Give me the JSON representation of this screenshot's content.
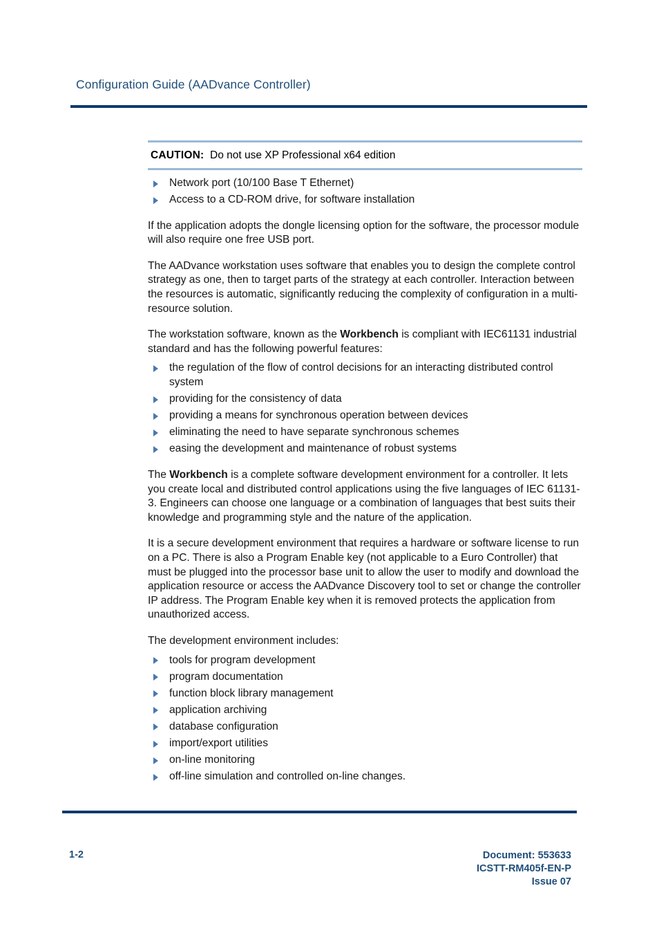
{
  "header": {
    "title": "Configuration Guide (AADvance Controller)",
    "title_color": "#1f4e79",
    "rule_color": "#0d3a6b"
  },
  "caution": {
    "label": "CAUTION:",
    "text": "Do not use XP Professional x64 edition",
    "rule_color": "#9ab9d6",
    "items": [
      "Network port (10/100 Base T Ethernet)",
      "Access to a CD-ROM drive, for software installation"
    ]
  },
  "body": {
    "bullet_color": "#4a78ac",
    "para_dongle": "If the application adopts the dongle licensing option for the software, the processor module will also require one free USB port.",
    "para_workstation": "The AADvance workstation uses software that enables you to design the complete control strategy as one, then to target parts of the strategy at each controller. Interaction between the resources is automatic, significantly reducing the complexity of configuration in a multi-resource solution.",
    "para_workbench_intro_pre": "The workstation software, known as the ",
    "para_workbench_intro_bold": "Workbench",
    "para_workbench_intro_post": " is compliant with IEC61131 industrial standard and has the following powerful features:",
    "features": [
      "the regulation of the flow of control decisions for an interacting distributed control system",
      "providing for the consistency of data",
      "providing a means for synchronous operation between devices",
      "eliminating the need to have separate synchronous schemes",
      "easing the development and maintenance of robust systems"
    ],
    "para_workbench_desc_pre": "The ",
    "para_workbench_desc_bold": "Workbench",
    "para_workbench_desc_post": " is a complete software development environment for a controller. It lets you create local and distributed control applications using the five languages of IEC 61131-3. Engineers can choose one language or a combination of languages that best suits their knowledge and programming style and the nature of the application.",
    "para_secure": "It is a secure development environment that requires a hardware or software license to run on a PC. There is also a Program Enable key (not applicable to a Euro Controller) that must be plugged into the processor base unit to allow the user to modify and download the application resource or access the AADvance Discovery tool to set or change the controller IP address. The Program Enable key when it is removed protects the application from unauthorized access.",
    "para_dev_env": "The development environment includes:",
    "dev_env_items": [
      "tools for program development",
      "program documentation",
      "function block library management",
      "application archiving",
      "database configuration",
      "import/export utilities",
      "on-line monitoring",
      "off-line simulation and controlled on-line changes."
    ]
  },
  "footer": {
    "page_number": "1-2",
    "document": "Document: 553633",
    "part_number": "ICSTT-RM405f-EN-P",
    "issue": "Issue 07",
    "rule_color": "#0d3a6b",
    "text_color": "#1f4e79"
  }
}
